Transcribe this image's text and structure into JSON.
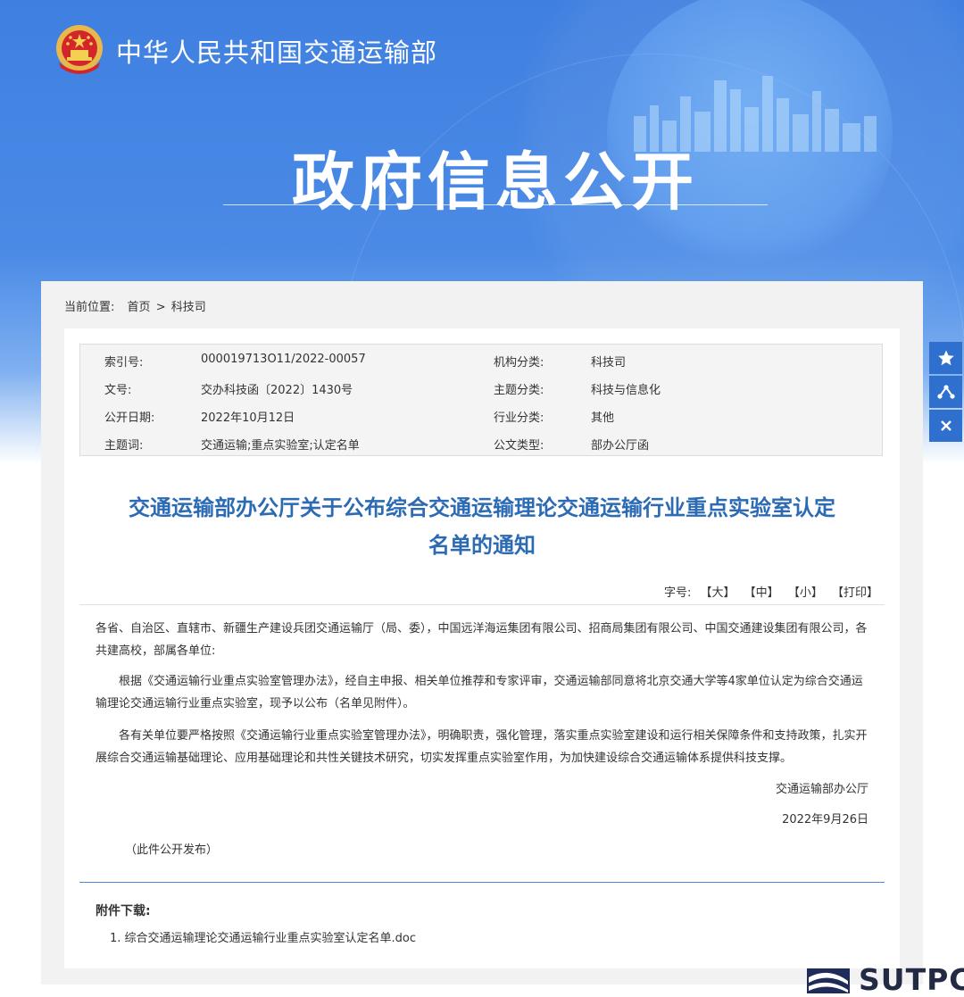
{
  "header": {
    "ministry_name": "中华人民共和国交通运输部",
    "section_title": "政府信息公开"
  },
  "breadcrumb": {
    "prefix": "当前位置:",
    "home": "首页",
    "separator": ">",
    "current": "科技司"
  },
  "meta": {
    "rows": [
      {
        "k1": "索引号:",
        "v1": "000019713O11/2022-00057",
        "k2": "机构分类:",
        "v2": "科技司"
      },
      {
        "k1": "文号:",
        "v1": "交办科技函〔2022〕1430号",
        "k2": "主题分类:",
        "v2": "科技与信息化"
      },
      {
        "k1": "公开日期:",
        "v1": "2022年10月12日",
        "k2": "行业分类:",
        "v2": "其他"
      },
      {
        "k1": "主题词:",
        "v1": "交通运输;重点实验室;认定名单",
        "k2": "公文类型:",
        "v2": "部办公厅函"
      }
    ]
  },
  "document": {
    "title_line1": "交通运输部办公厅关于公布综合交通运输理论交通运输行业重点实验室认定",
    "title_line2": "名单的通知",
    "font_size_label": "字号:",
    "font_large": "【大】",
    "font_medium": "【中】",
    "font_small": "【小】",
    "print": "【打印】",
    "para1": "各省、自治区、直辖市、新疆生产建设兵团交通运输厅（局、委），中国远洋海运集团有限公司、招商局集团有限公司、中国交通建设集团有限公司，各共建高校，部属各单位:",
    "para2": "根据《交通运输行业重点实验室管理办法》，经自主申报、相关单位推荐和专家评审，交通运输部同意将北京交通大学等4家单位认定为综合交通运输理论交通运输行业重点实验室，现予以公布（名单见附件）。",
    "para3": "各有关单位要严格按照《交通运输行业重点实验室管理办法》，明确职责，强化管理，落实重点实验室建设和运行相关保障条件和支持政策，扎实开展综合交通运输基础理论、应用基础理论和共性关键技术研究，切实发挥重点实验室作用，为加快建设综合交通运输体系提供科技支撑。",
    "signature": "交通运输部办公厅",
    "date": "2022年9月26日",
    "note": "（此件公开发布）"
  },
  "attachments": {
    "heading": "附件下载:",
    "items": [
      "1. 综合交通运输理论交通运输行业重点实验室认定名单.doc"
    ]
  },
  "side_tools": [
    "star-icon",
    "share-icon",
    "close-icon"
  ],
  "watermark": {
    "text": "SUTPC"
  },
  "colors": {
    "brand_blue": "#3f7fe0",
    "title_blue": "#2c6bb3",
    "side_button": "#2f6fce",
    "divider_blue": "#4a86d8"
  }
}
